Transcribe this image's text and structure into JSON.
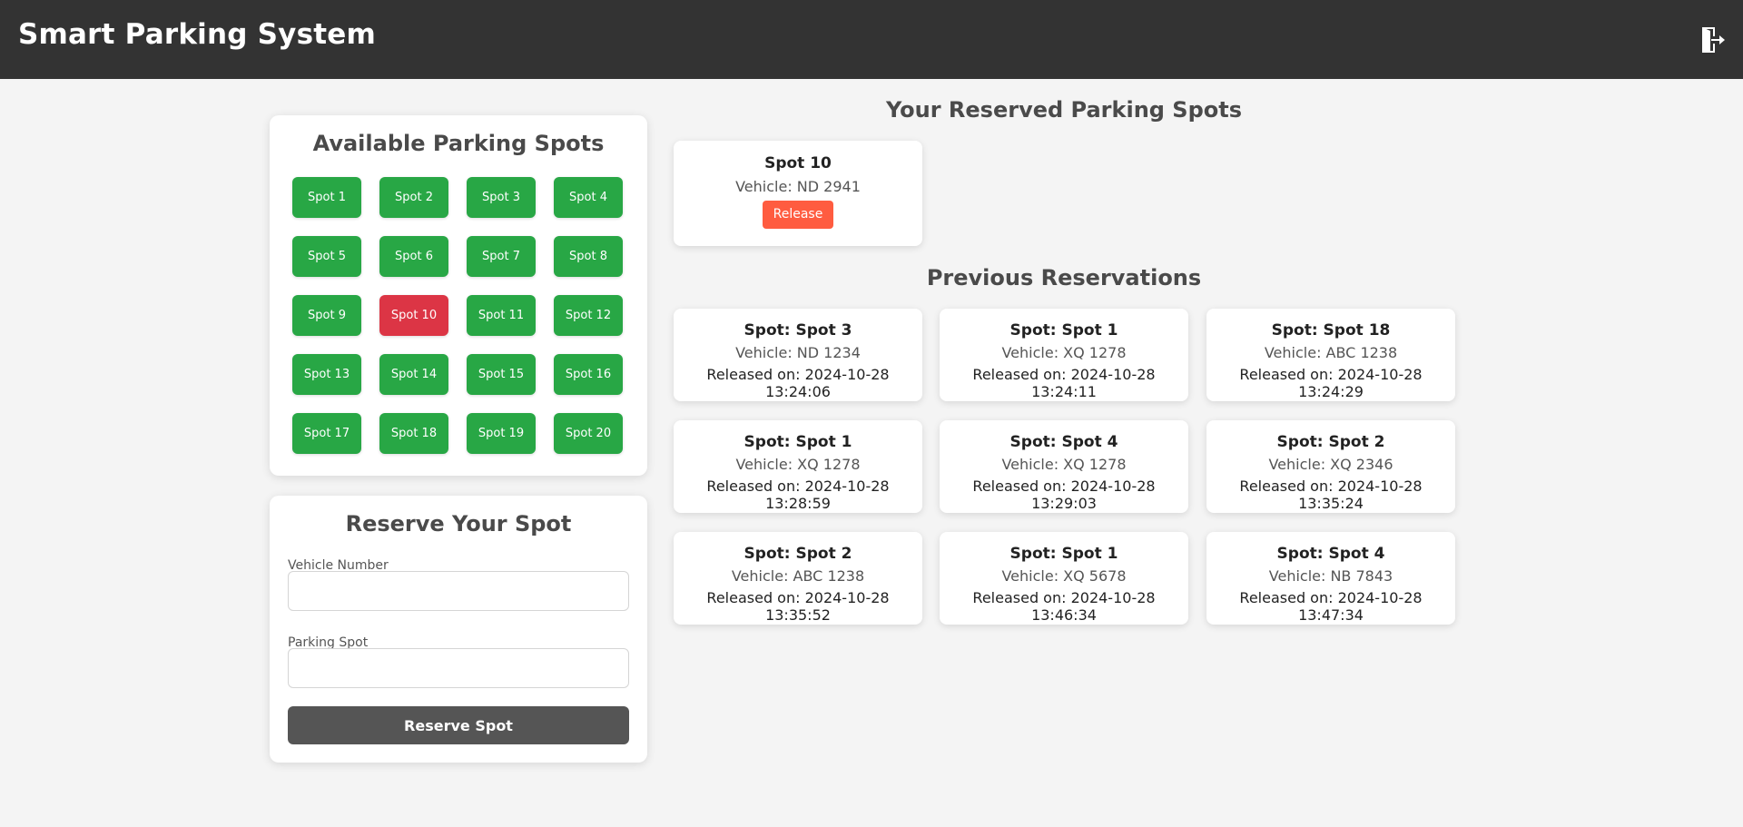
{
  "header": {
    "title": "Smart Parking System",
    "logout_icon": "logout-icon"
  },
  "available": {
    "title": "Available Parking Spots",
    "spots": [
      {
        "label": "Spot 1",
        "status": "available"
      },
      {
        "label": "Spot 2",
        "status": "available"
      },
      {
        "label": "Spot 3",
        "status": "available"
      },
      {
        "label": "Spot 4",
        "status": "available"
      },
      {
        "label": "Spot 5",
        "status": "available"
      },
      {
        "label": "Spot 6",
        "status": "available"
      },
      {
        "label": "Spot 7",
        "status": "available"
      },
      {
        "label": "Spot 8",
        "status": "available"
      },
      {
        "label": "Spot 9",
        "status": "available"
      },
      {
        "label": "Spot 10",
        "status": "reserved"
      },
      {
        "label": "Spot 11",
        "status": "available"
      },
      {
        "label": "Spot 12",
        "status": "available"
      },
      {
        "label": "Spot 13",
        "status": "available"
      },
      {
        "label": "Spot 14",
        "status": "available"
      },
      {
        "label": "Spot 15",
        "status": "available"
      },
      {
        "label": "Spot 16",
        "status": "available"
      },
      {
        "label": "Spot 17",
        "status": "available"
      },
      {
        "label": "Spot 18",
        "status": "available"
      },
      {
        "label": "Spot 19",
        "status": "available"
      },
      {
        "label": "Spot 20",
        "status": "available"
      }
    ]
  },
  "reserve_form": {
    "title": "Reserve Your Spot",
    "vehicle_label": "Vehicle Number",
    "vehicle_value": "",
    "spot_label": "Parking Spot",
    "spot_value": "",
    "submit_label": "Reserve Spot"
  },
  "reserved": {
    "title": "Your Reserved Parking Spots",
    "items": [
      {
        "spot": "Spot 10",
        "vehicle": "Vehicle: ND 2941",
        "release_label": "Release"
      }
    ]
  },
  "previous": {
    "title": "Previous Reservations",
    "items": [
      {
        "spot": "Spot: Spot 3",
        "vehicle": "Vehicle: ND 1234",
        "released": "Released on: 2024-10-28 13:24:06"
      },
      {
        "spot": "Spot: Spot 1",
        "vehicle": "Vehicle: XQ 1278",
        "released": "Released on: 2024-10-28 13:24:11"
      },
      {
        "spot": "Spot: Spot 18",
        "vehicle": "Vehicle: ABC 1238",
        "released": "Released on: 2024-10-28 13:24:29"
      },
      {
        "spot": "Spot: Spot 1",
        "vehicle": "Vehicle: XQ 1278",
        "released": "Released on: 2024-10-28 13:28:59"
      },
      {
        "spot": "Spot: Spot 4",
        "vehicle": "Vehicle: XQ 1278",
        "released": "Released on: 2024-10-28 13:29:03"
      },
      {
        "spot": "Spot: Spot 2",
        "vehicle": "Vehicle: XQ 2346",
        "released": "Released on: 2024-10-28 13:35:24"
      },
      {
        "spot": "Spot: Spot 2",
        "vehicle": "Vehicle: ABC 1238",
        "released": "Released on: 2024-10-28 13:35:52"
      },
      {
        "spot": "Spot: Spot 1",
        "vehicle": "Vehicle: XQ 5678",
        "released": "Released on: 2024-10-28 13:46:34"
      },
      {
        "spot": "Spot: Spot 4",
        "vehicle": "Vehicle: NB 7843",
        "released": "Released on: 2024-10-28 13:47:34"
      }
    ]
  },
  "colors": {
    "header_bg": "#333333",
    "available": "#28a745",
    "reserved": "#dc3545",
    "release": "#ff5c40",
    "submit": "#555555"
  }
}
